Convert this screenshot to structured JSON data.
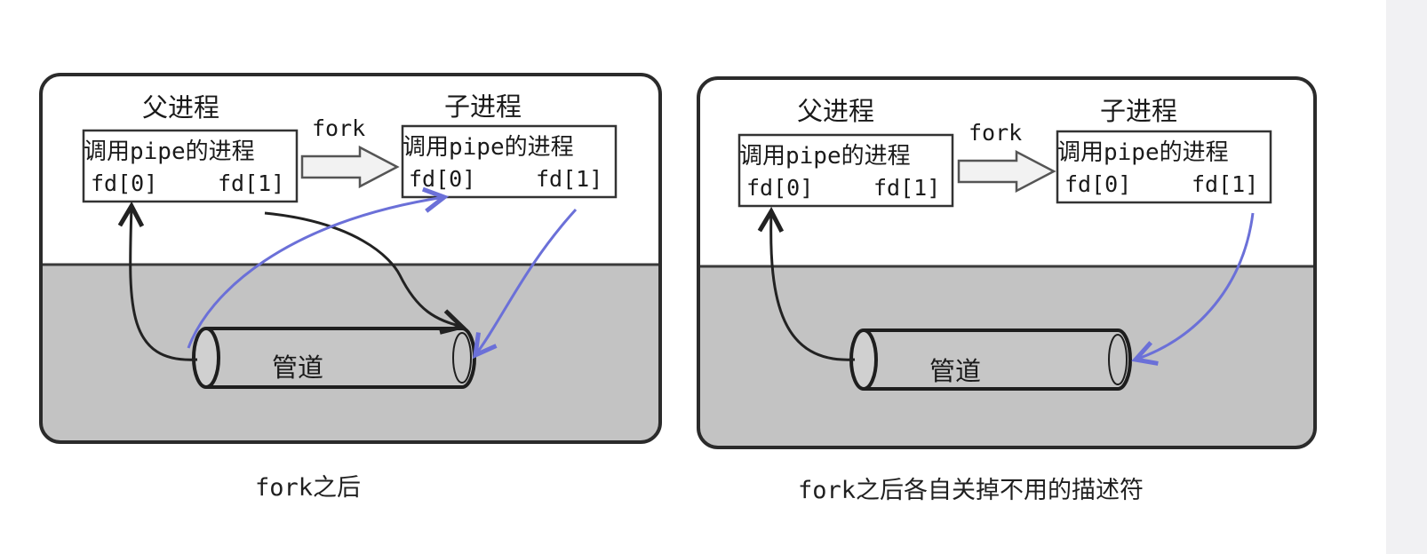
{
  "panels": [
    {
      "parent_label": "父进程",
      "child_label": "子进程",
      "fork_label": "fork",
      "parent_box": {
        "title": "调用pipe的进程",
        "fd0": "fd[0]",
        "fd1": "fd[1]"
      },
      "child_box": {
        "title": "调用pipe的进程",
        "fd0": "fd[0]",
        "fd1": "fd[1]"
      },
      "pipe_label": "管道",
      "caption": "fork之后"
    },
    {
      "parent_label": "父进程",
      "child_label": "子进程",
      "fork_label": "fork",
      "parent_box": {
        "title": "调用pipe的进程",
        "fd0": "fd[0]",
        "fd1": "fd[1]"
      },
      "child_box": {
        "title": "调用pipe的进程",
        "fd0": "fd[0]",
        "fd1": "fd[1]"
      },
      "pipe_label": "管道",
      "caption": "fork之后各自关掉不用的描述符"
    }
  ],
  "colors": {
    "panel_top": "#ffffff",
    "panel_bottom": "#c3c3c3",
    "outline": "#2b2b2b",
    "blue_arrow": "#6b70d8"
  }
}
